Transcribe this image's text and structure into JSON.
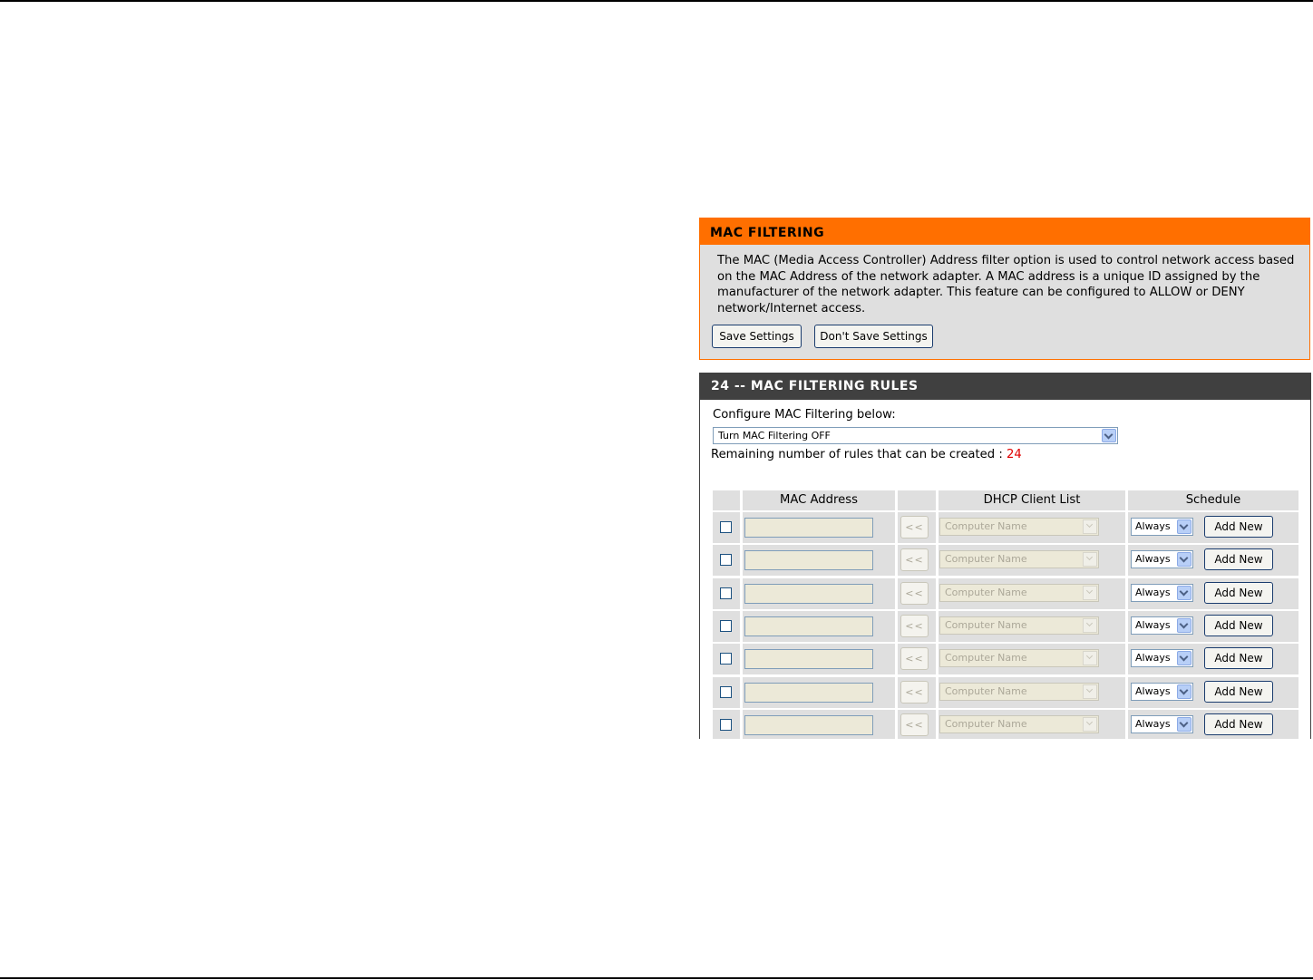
{
  "mac_filtering": {
    "title": "MAC FILTERING",
    "description": "The MAC (Media Access Controller) Address filter option is used to control network access based on the MAC Address of the network adapter. A MAC address is a unique ID assigned by the manufacturer of the network adapter. This feature can be configured to ALLOW or DENY network/Internet access.",
    "save_label": "Save Settings",
    "dont_save_label": "Don't Save Settings"
  },
  "rules": {
    "title": "24 -- MAC FILTERING RULES",
    "configure_label": "Configure MAC Filtering below:",
    "mode_value": "Turn MAC Filtering OFF",
    "remaining_label": "Remaining number of rules that can be created : ",
    "remaining_count": "24",
    "columns": {
      "mac": "MAC Address",
      "dhcp": "DHCP Client List",
      "schedule": "Schedule"
    },
    "rows": [
      {
        "mac": "",
        "copy": "<<",
        "dhcp": "Computer Name",
        "schedule": "Always",
        "add": "Add New"
      },
      {
        "mac": "",
        "copy": "<<",
        "dhcp": "Computer Name",
        "schedule": "Always",
        "add": "Add New"
      },
      {
        "mac": "",
        "copy": "<<",
        "dhcp": "Computer Name",
        "schedule": "Always",
        "add": "Add New"
      },
      {
        "mac": "",
        "copy": "<<",
        "dhcp": "Computer Name",
        "schedule": "Always",
        "add": "Add New"
      },
      {
        "mac": "",
        "copy": "<<",
        "dhcp": "Computer Name",
        "schedule": "Always",
        "add": "Add New"
      },
      {
        "mac": "",
        "copy": "<<",
        "dhcp": "Computer Name",
        "schedule": "Always",
        "add": "Add New"
      },
      {
        "mac": "",
        "copy": "<<",
        "dhcp": "Computer Name",
        "schedule": "Always",
        "add": "Add New"
      }
    ]
  },
  "colors": {
    "orange_header": "#ff6f00",
    "dark_header": "#404040",
    "panel_bg": "#dfdfdf",
    "remaining_count": "#e00000"
  }
}
